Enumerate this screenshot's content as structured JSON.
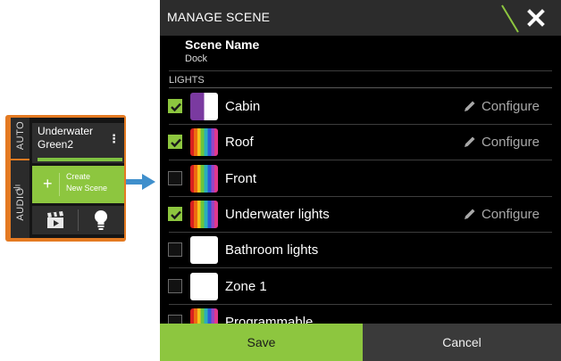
{
  "inset": {
    "tab_auto": "AUTO",
    "tab_audio": "AUDIO",
    "bars_icon": "ılı",
    "scene_line1": "Underwater",
    "scene_line2": "Green2",
    "menu_dots": "⋮",
    "create_plus": "+",
    "create_line1": "Create",
    "create_line2": "New Scene"
  },
  "dialog": {
    "title": "MANAGE SCENE",
    "scene_name_label": "Scene Name",
    "scene_name_value": "Dock",
    "section_title": "LIGHTS",
    "configure_label": "Configure",
    "lights": [
      {
        "name": "Cabin",
        "checked": true,
        "swatch": "split",
        "configure": true
      },
      {
        "name": "Roof",
        "checked": true,
        "swatch": "rainbow",
        "configure": true
      },
      {
        "name": "Front",
        "checked": false,
        "swatch": "rainbow",
        "configure": false
      },
      {
        "name": "Underwater lights",
        "checked": true,
        "swatch": "rainbow",
        "configure": true
      },
      {
        "name": "Bathroom lights",
        "checked": false,
        "swatch": "white",
        "configure": false
      },
      {
        "name": "Zone 1",
        "checked": false,
        "swatch": "white",
        "configure": false
      },
      {
        "name": "Programmable",
        "checked": false,
        "swatch": "rainbow",
        "configure": false
      }
    ],
    "save_label": "Save",
    "cancel_label": "Cancel"
  },
  "colors": {
    "accent_green": "#8dc63f",
    "inset_border": "#e47a22",
    "arrow_blue": "#3f8fcc"
  },
  "icons": [
    "bars-icon",
    "menu-dots-icon",
    "plus-icon",
    "clapperboard-icon",
    "lightbulb-icon",
    "arrow-right-icon",
    "close-icon",
    "checkmark-icon",
    "pencil-icon"
  ]
}
